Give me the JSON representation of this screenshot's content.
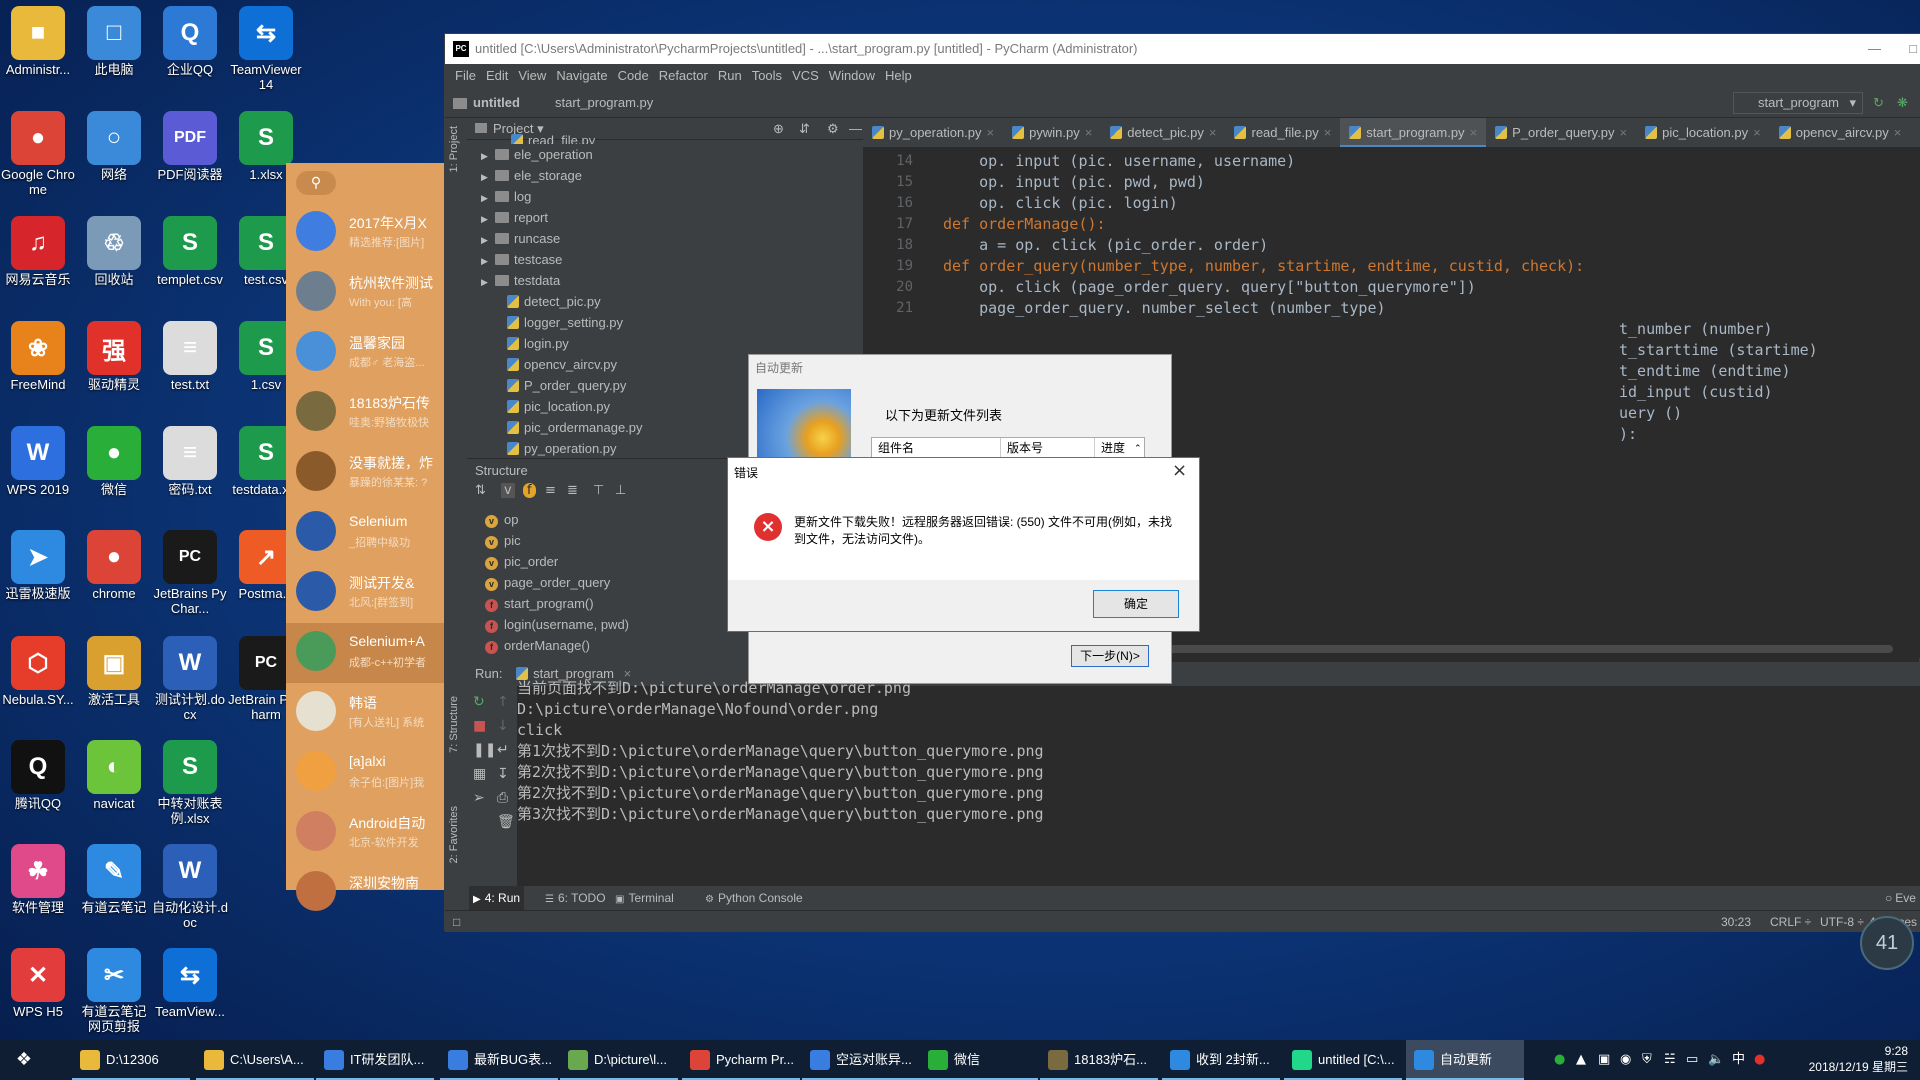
{
  "desktop_icons": [
    {
      "label": "Administr...",
      "color": "#e8b93a",
      "glyph": "■"
    },
    {
      "label": "此电脑",
      "color": "#3a8ad9",
      "glyph": "□"
    },
    {
      "label": "企业QQ",
      "color": "#2c7ad6",
      "glyph": "Q"
    },
    {
      "label": "TeamViewer 14",
      "color": "#0e6fd6",
      "glyph": "⇆"
    },
    {
      "label": "Google Chrome",
      "color": "#db4437",
      "glyph": "●"
    },
    {
      "label": "网络",
      "color": "#3a8ad9",
      "glyph": "○"
    },
    {
      "label": "PDF阅读器",
      "color": "#5b5bd6",
      "glyph": "PDF"
    },
    {
      "label": "1.xlsx",
      "color": "#1e9a4c",
      "glyph": "S"
    },
    {
      "label": "网易云音乐",
      "color": "#d7262b",
      "glyph": "♫"
    },
    {
      "label": "回收站",
      "color": "#7a9ab8",
      "glyph": "♲"
    },
    {
      "label": "templet.csv",
      "color": "#1e9a4c",
      "glyph": "S"
    },
    {
      "label": "test.csv",
      "color": "#1e9a4c",
      "glyph": "S"
    },
    {
      "label": "FreeMind",
      "color": "#e8821a",
      "glyph": "❀"
    },
    {
      "label": "驱动精灵",
      "color": "#e0312b",
      "glyph": "强"
    },
    {
      "label": "test.txt",
      "color": "#dcdcdc",
      "glyph": "≡"
    },
    {
      "label": "1.csv",
      "color": "#1e9a4c",
      "glyph": "S"
    },
    {
      "label": "WPS 2019",
      "color": "#2e6fe0",
      "glyph": "W"
    },
    {
      "label": "微信",
      "color": "#2aae3a",
      "glyph": "●"
    },
    {
      "label": "密码.txt",
      "color": "#dcdcdc",
      "glyph": "≡"
    },
    {
      "label": "testdata.x...",
      "color": "#1e9a4c",
      "glyph": "S"
    },
    {
      "label": "迅雷极速版",
      "color": "#2e8ae0",
      "glyph": "➤"
    },
    {
      "label": "chrome",
      "color": "#db4437",
      "glyph": "●"
    },
    {
      "label": "JetBrains PyChar...",
      "color": "#1a1a1a",
      "glyph": "PC"
    },
    {
      "label": "Postma...",
      "color": "#ef5b25",
      "glyph": "↗"
    },
    {
      "label": "Nebula.SY...",
      "color": "#e63c2a",
      "glyph": "⬡"
    },
    {
      "label": "激活工具",
      "color": "#d9a030",
      "glyph": "▣"
    },
    {
      "label": "测试计划.docx",
      "color": "#2b5fb8",
      "glyph": "W"
    },
    {
      "label": "JetBrain PyCharm",
      "color": "#1a1a1a",
      "glyph": "PC"
    },
    {
      "label": "腾讯QQ",
      "color": "#111111",
      "glyph": "Q"
    },
    {
      "label": "navicat",
      "color": "#6cc43a",
      "glyph": "◐"
    },
    {
      "label": "中转对账表例.xlsx",
      "color": "#1e9a4c",
      "glyph": "S"
    },
    {
      "label": "软件管理",
      "color": "#e04a8a",
      "glyph": "☘"
    },
    {
      "label": "有道云笔记",
      "color": "#2e8ae0",
      "glyph": "✎"
    },
    {
      "label": "自动化设计.doc",
      "color": "#2b5fb8",
      "glyph": "W"
    },
    {
      "label": "WPS H5",
      "color": "#e23c3c",
      "glyph": "✕"
    },
    {
      "label": "有道云笔记网页剪报",
      "color": "#2e8ae0",
      "glyph": "✂"
    },
    {
      "label": "TeamView...",
      "color": "#0e6fd6",
      "glyph": "⇆"
    }
  ],
  "chat": {
    "items": [
      {
        "name": "2017年X月X",
        "preview": "精选推荐:[图片]",
        "color": "#3f7de0"
      },
      {
        "name": "杭州软件测试",
        "preview": "With you: [高",
        "color": "#6d7f8f"
      },
      {
        "name": "温馨家园",
        "preview": "成都♂ 老海盗...",
        "color": "#4a90d9"
      },
      {
        "name": "18183炉石传",
        "preview": "哇奥:野猪牧极快",
        "color": "#7a6a40"
      },
      {
        "name": "没事就搓，炸",
        "preview": "暴躁的徐某某: ?",
        "color": "#8a5a2a"
      },
      {
        "name": "Selenium",
        "preview": "_招聘中级功",
        "color": "#2a5aa8"
      },
      {
        "name": "测试开发&",
        "preview": "北风:[群签到]",
        "color": "#2a5aa8"
      },
      {
        "name": "Selenium+A",
        "preview": "成都-c++初学者",
        "color": "#4a9a5a"
      },
      {
        "name": "韩语",
        "preview": "[有人送礼] 系统",
        "color": "#e6e0d0"
      },
      {
        "name": "[a]alxi",
        "preview": "余子伯:[图片]我",
        "color": "#f0a040"
      },
      {
        "name": "Android自动",
        "preview": "北京-软件开发",
        "color": "#d08060"
      },
      {
        "name": "深圳安物南",
        "preview": "",
        "color": "#c07040"
      }
    ]
  },
  "pycharm": {
    "title": "untitled [C:\\Users\\Administrator\\PycharmProjects\\untitled] - ...\\start_program.py [untitled] - PyCharm (Administrator)",
    "menu": [
      "File",
      "Edit",
      "View",
      "Navigate",
      "Code",
      "Refactor",
      "Run",
      "Tools",
      "VCS",
      "Window",
      "Help"
    ],
    "breadcrumb": {
      "project": "untitled",
      "file": "start_program.py"
    },
    "run_config": "start_program",
    "project_panel": {
      "header": "Project",
      "folders": [
        "ele_operation",
        "ele_storage",
        "log",
        "report",
        "runcase",
        "testcase",
        "testdata"
      ],
      "files": [
        "detect_pic.py",
        "logger_setting.py",
        "login.py",
        "opencv_aircv.py",
        "P_order_query.py",
        "pic_location.py",
        "pic_ordermanage.py",
        "py_operation.py"
      ],
      "cut_top": "read_file.py"
    },
    "side_tabs": {
      "project": "1: Project",
      "structure": "7: Structure",
      "favorites": "2: Favorites"
    },
    "structure": {
      "header": "Structure",
      "items": [
        {
          "badge": "v",
          "label": "op"
        },
        {
          "badge": "v",
          "label": "pic"
        },
        {
          "badge": "v",
          "label": "pic_order"
        },
        {
          "badge": "v",
          "label": "page_order_query"
        },
        {
          "badge": "f",
          "label": "start_program()"
        },
        {
          "badge": "f",
          "label": "login(username, pwd)"
        },
        {
          "badge": "f",
          "label": "orderManage()"
        }
      ]
    },
    "tabs": [
      "py_operation.py",
      "pywin.py",
      "detect_pic.py",
      "read_file.py",
      "start_program.py",
      "P_order_query.py",
      "pic_location.py",
      "opencv_aircv.py"
    ],
    "active_tab": "start_program.py",
    "line_numbers": [
      "14",
      "15",
      "16",
      "17",
      "18",
      "19",
      "20",
      "21"
    ],
    "code_lines": [
      "    op. input (pic. username, username)",
      "    op. input (pic. pwd, pwd)",
      "    op. click (pic. login)",
      "def orderManage():",
      "    a = op. click (pic_order. order)",
      "def order_query(number_type, number, startime, endtime, custid, check):",
      "    op. click (page_order_query. query[\"button_querymore\"])",
      "    page_order_query. number_select (number_type)"
    ],
    "code_tail": [
      "t_number (number)",
      "t_starttime (startime)",
      "t_endtime (endtime)",
      "id_input (custid)",
      "uery ()",
      "):"
    ],
    "run": {
      "label": "Run:",
      "config": "start_program",
      "output": [
        "当前页面找不到D:\\picture\\orderManage\\order.png",
        "D:\\picture\\orderManage\\Nofound\\order.png",
        "click",
        "第1次找不到D:\\picture\\orderManage\\query\\button_querymore.png",
        "第2次找不到D:\\picture\\orderManage\\query\\button_querymore.png",
        "第2次找不到D:\\picture\\orderManage\\query\\button_querymore.png",
        "第3次找不到D:\\picture\\orderManage\\query\\button_querymore.png"
      ]
    },
    "bottom_tabs": [
      "4: Run",
      "6: TODO",
      "Terminal",
      "Python Console"
    ],
    "event_log": "Eve",
    "status": {
      "position": "30:23",
      "line_sep": "CRLF ÷",
      "encoding": "UTF-8 ÷",
      "indent": "4 spaces"
    }
  },
  "update_dialog": {
    "title": "自动更新",
    "subtitle": "以下为更新文件列表",
    "columns": [
      "组件名",
      "版本号",
      "进度"
    ],
    "next_button": "下一步(N)>"
  },
  "error_dialog": {
    "title": "错误",
    "message": "更新文件下载失败！远程服务器返回错误: (550) 文件不可用(例如，未找到文件，无法访问文件)。",
    "ok_button": "确定"
  },
  "widget_badge": "41",
  "taskbar": {
    "items": [
      {
        "label": "D:\\12306",
        "color": "#e8b93a"
      },
      {
        "label": "C:\\Users\\A...",
        "color": "#e8b93a"
      },
      {
        "label": "IT研发团队...",
        "color": "#3a7de0"
      },
      {
        "label": "最新BUG表...",
        "color": "#3a7de0"
      },
      {
        "label": "D:\\picture\\l...",
        "color": "#6aa84f"
      },
      {
        "label": "Pycharm Pr...",
        "color": "#db4437"
      },
      {
        "label": "空运对账异...",
        "color": "#3a7de0"
      },
      {
        "label": "微信",
        "color": "#2aae3a"
      },
      {
        "label": "18183炉石...",
        "color": "#7a6a40"
      },
      {
        "label": "收到 2封新...",
        "color": "#2e8ae0"
      },
      {
        "label": "untitled [C:\\...",
        "color": "#21d789"
      },
      {
        "label": "自动更新",
        "color": "#2e8ae0"
      }
    ],
    "active_index": 11,
    "tray_lang": "中",
    "time": "9:28",
    "date": "2018/12/19 星期三"
  }
}
